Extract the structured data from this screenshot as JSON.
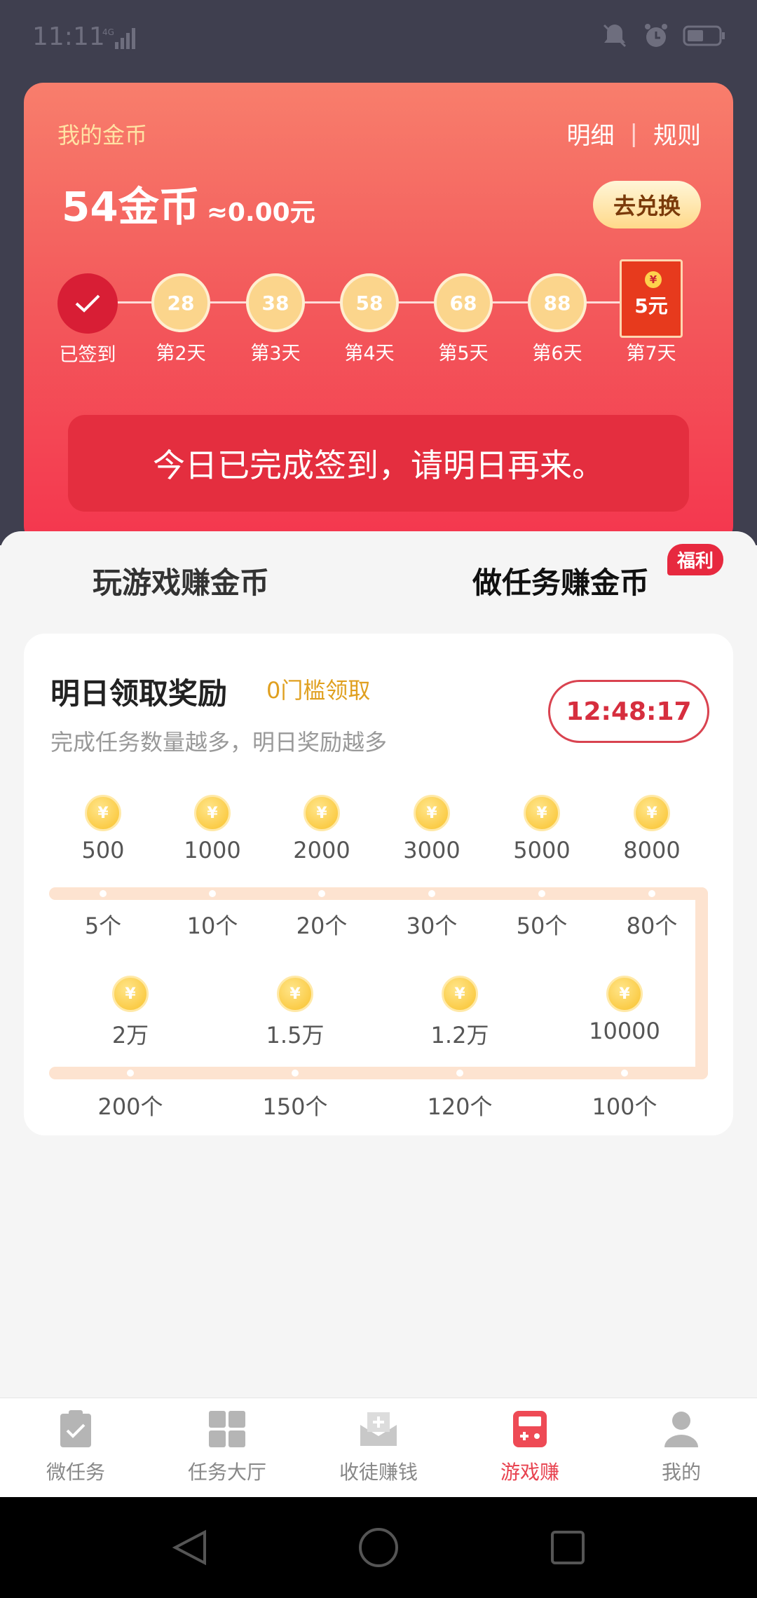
{
  "status": {
    "time": "11:11",
    "network": "4G"
  },
  "card": {
    "my_coins_label": "我的金币",
    "detail_link": "明细",
    "separator": "|",
    "rules_link": "规则",
    "balance": "54",
    "balance_unit": "金币",
    "approx": "≈0.00元",
    "exchange_button": "去兑换",
    "checkin_steps": [
      {
        "label": "已签到",
        "value": "",
        "done": true
      },
      {
        "label": "第2天",
        "value": "28"
      },
      {
        "label": "第3天",
        "value": "38"
      },
      {
        "label": "第4天",
        "value": "58"
      },
      {
        "label": "第5天",
        "value": "68"
      },
      {
        "label": "第6天",
        "value": "88"
      },
      {
        "label": "第7天",
        "value": "5元",
        "red_packet": true
      }
    ],
    "signed_message": "今日已完成签到，请明日再来。"
  },
  "tabs": {
    "play_games": "玩游戏赚金币",
    "do_tasks": "做任务赚金币",
    "welfare_badge": "福利"
  },
  "reward_panel": {
    "title": "明日领取奖励",
    "subtitle": "0门槛领取",
    "description": "完成任务数量越多，明日奖励越多",
    "countdown": "12:48:17",
    "coin_symbol": "¥",
    "row1": [
      {
        "amount": "500",
        "tasks": "5个"
      },
      {
        "amount": "1000",
        "tasks": "10个"
      },
      {
        "amount": "2000",
        "tasks": "20个"
      },
      {
        "amount": "3000",
        "tasks": "30个"
      },
      {
        "amount": "5000",
        "tasks": "50个"
      },
      {
        "amount": "8000",
        "tasks": "80个"
      }
    ],
    "row2": [
      {
        "amount": "2万",
        "tasks": "200个"
      },
      {
        "amount": "1.5万",
        "tasks": "150个"
      },
      {
        "amount": "1.2万",
        "tasks": "120个"
      },
      {
        "amount": "10000",
        "tasks": "100个"
      }
    ]
  },
  "bottom_nav": [
    {
      "label": "微任务",
      "icon": "clipboard-check-icon"
    },
    {
      "label": "任务大厅",
      "icon": "grid-icon"
    },
    {
      "label": "收徒赚钱",
      "icon": "envelope-plus-icon"
    },
    {
      "label": "游戏赚",
      "icon": "gamepad-icon",
      "active": true
    },
    {
      "label": "我的",
      "icon": "user-icon"
    }
  ],
  "colors": {
    "accent": "#e8424f",
    "card_top": "#f87e6c",
    "card_bottom": "#f4364e",
    "gold": "#f9c22d"
  }
}
